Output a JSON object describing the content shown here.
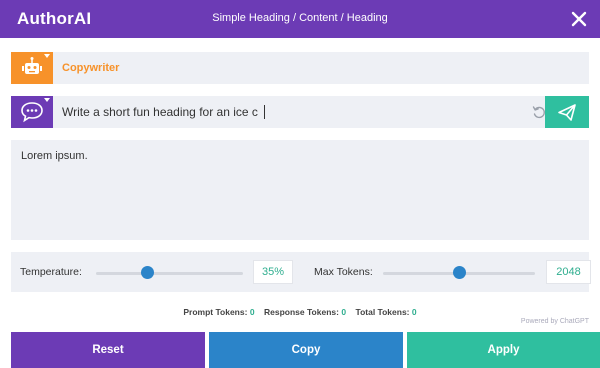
{
  "header": {
    "logo": "AuthorAI",
    "breadcrumb": "Simple Heading / Content / Heading",
    "close_icon": "close-icon"
  },
  "role": {
    "icon": "robot-icon",
    "label": "Copywriter",
    "color": "#f7922a"
  },
  "prompt": {
    "icon": "chat-bubble-icon",
    "value": "Write a short fun heading for an ice c",
    "undo_icon": "undo-icon",
    "send_icon": "send-icon"
  },
  "output": {
    "text": "Lorem ipsum."
  },
  "settings": {
    "temperature": {
      "label": "Temperature:",
      "value_text": "35%",
      "level": 0.35
    },
    "max_tokens": {
      "label": "Max Tokens:",
      "value_text": "2048",
      "level": 0.5
    }
  },
  "tokens": {
    "prompt_label": "Prompt Tokens:",
    "prompt_value": "0",
    "response_label": "Response Tokens:",
    "response_value": "0",
    "total_label": "Total Tokens:",
    "total_value": "0"
  },
  "powered_by": "Powered by ChatGPT",
  "actions": {
    "reset": "Reset",
    "copy": "Copy",
    "apply": "Apply"
  },
  "colors": {
    "purple": "#6c3bb5",
    "orange": "#f7922a",
    "blue": "#2b84c9",
    "green": "#2fbf9f"
  }
}
